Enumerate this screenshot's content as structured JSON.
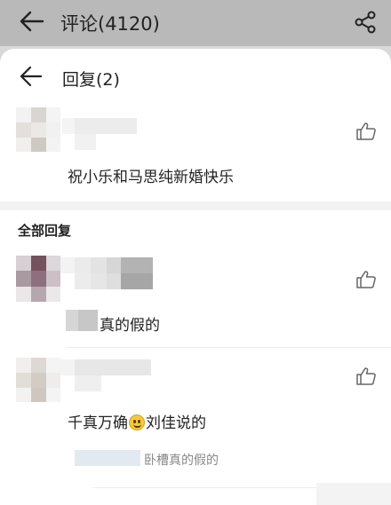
{
  "page_header": {
    "title": "评论(4120)",
    "back_icon": "arrow-left-icon",
    "share_icon": "share-icon"
  },
  "sheet": {
    "title": "回复(2)",
    "back_icon": "arrow-left-icon",
    "root_comment": {
      "text": "祝小乐和马思纯新婚快乐",
      "like_icon": "thumbs-up-icon"
    },
    "section_title": "全部回复",
    "replies": [
      {
        "text": "真的假的",
        "like_icon": "thumbs-up-icon"
      },
      {
        "text_before_emoji": "千真万确",
        "emoji": "grinning-face-emoji",
        "text_after_emoji": "刘佳说的",
        "nested_reply": "卧槽真的假的",
        "like_icon": "thumbs-up-icon"
      }
    ]
  },
  "colors": {
    "dim_overlay": "#b9b9b9",
    "sheet_background": "#ffffff",
    "secondary_text": "#888888"
  }
}
